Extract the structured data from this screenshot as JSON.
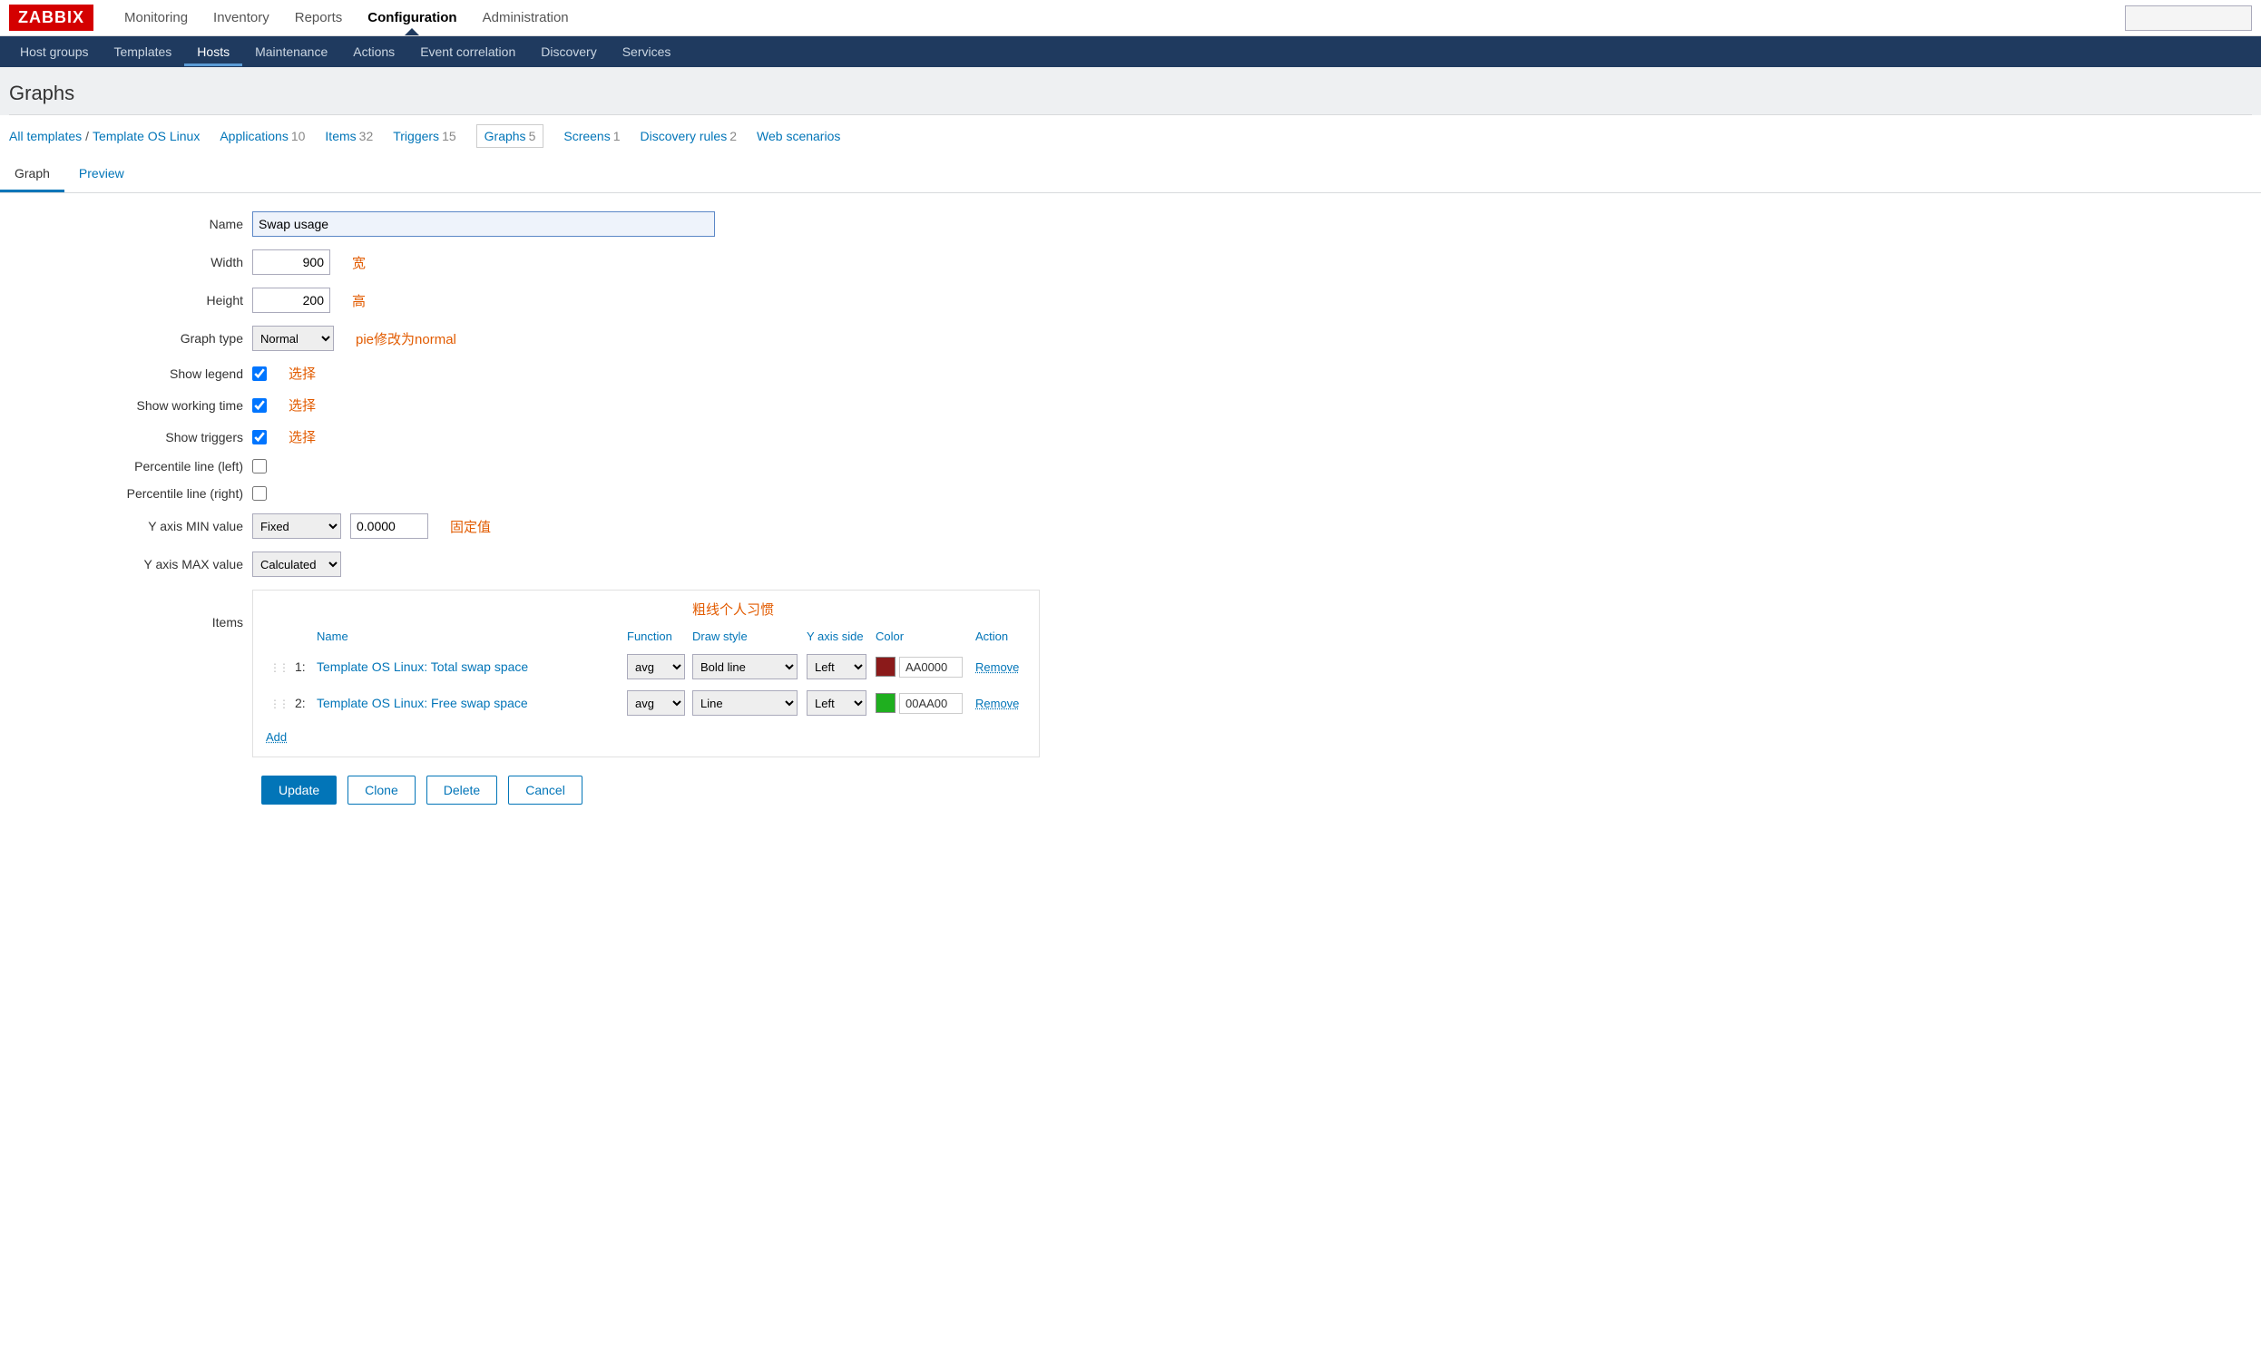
{
  "logo": "ZABBIX",
  "topnav": [
    "Monitoring",
    "Inventory",
    "Reports",
    "Configuration",
    "Administration"
  ],
  "topnav_active": 3,
  "subnav": [
    "Host groups",
    "Templates",
    "Hosts",
    "Maintenance",
    "Actions",
    "Event correlation",
    "Discovery",
    "Services"
  ],
  "subnav_active": 2,
  "page_title": "Graphs",
  "breadcrumb": {
    "all_templates": "All templates",
    "template_name": "Template OS Linux",
    "items": [
      {
        "label": "Applications",
        "count": "10"
      },
      {
        "label": "Items",
        "count": "32"
      },
      {
        "label": "Triggers",
        "count": "15"
      },
      {
        "label": "Graphs",
        "count": "5",
        "active": true
      },
      {
        "label": "Screens",
        "count": "1"
      },
      {
        "label": "Discovery rules",
        "count": "2"
      },
      {
        "label": "Web scenarios",
        "count": ""
      }
    ]
  },
  "tabs": {
    "graph": "Graph",
    "preview": "Preview"
  },
  "form": {
    "labels": {
      "name": "Name",
      "width": "Width",
      "height": "Height",
      "graph_type": "Graph type",
      "show_legend": "Show legend",
      "show_working_time": "Show working time",
      "show_triggers": "Show triggers",
      "perc_left": "Percentile line (left)",
      "perc_right": "Percentile line (right)",
      "ymin": "Y axis MIN value",
      "ymax": "Y axis MAX value",
      "items": "Items"
    },
    "values": {
      "name": "Swap usage",
      "width": "900",
      "height": "200",
      "graph_type": "Normal",
      "show_legend": true,
      "show_working_time": true,
      "show_triggers": true,
      "perc_left": false,
      "perc_right": false,
      "ymin_mode": "Fixed",
      "ymin_value": "0.0000",
      "ymax_mode": "Calculated"
    },
    "annotations": {
      "width": "宽",
      "height": "高",
      "graph_type": "pie修改为normal",
      "show_legend": "选择",
      "show_working_time": "选择",
      "show_triggers": "选择",
      "ymin": "固定值",
      "draw_style": "粗线个人习惯"
    }
  },
  "items_table": {
    "headers": {
      "name": "Name",
      "function": "Function",
      "draw_style": "Draw style",
      "yaxis": "Y axis side",
      "color": "Color",
      "action": "Action"
    },
    "rows": [
      {
        "num": "1:",
        "name": "Template OS Linux: Total swap space",
        "function": "avg",
        "draw": "Bold line",
        "side": "Left",
        "color": "AA0000",
        "swatch": "#8B1A1A"
      },
      {
        "num": "2:",
        "name": "Template OS Linux: Free swap space",
        "function": "avg",
        "draw": "Line",
        "side": "Left",
        "color": "00AA00",
        "swatch": "#1FAF1F"
      }
    ],
    "add": "Add",
    "remove": "Remove"
  },
  "buttons": {
    "update": "Update",
    "clone": "Clone",
    "delete": "Delete",
    "cancel": "Cancel"
  }
}
